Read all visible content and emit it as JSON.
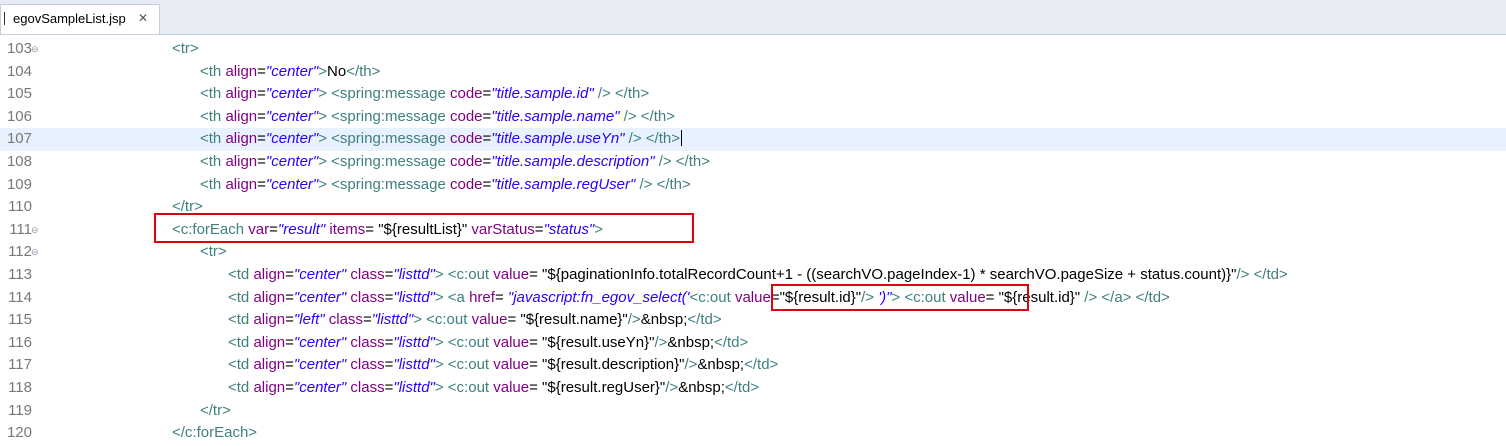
{
  "tab": {
    "label": "egovSampleList.jsp",
    "close_icon": "close-icon"
  },
  "editor": {
    "lines": [
      {
        "num": "103",
        "parts": [
          [
            "tg",
            "<tr>"
          ]
        ]
      },
      {
        "num": "104",
        "parts": [
          [
            "tg",
            "<th "
          ],
          [
            "at",
            "align"
          ],
          [
            "tx",
            "="
          ],
          [
            "vl",
            "\"center\""
          ],
          [
            "tg",
            ">"
          ],
          [
            "tx",
            "No"
          ],
          [
            "tg",
            "</th>"
          ]
        ]
      },
      {
        "num": "105",
        "parts": [
          [
            "tg",
            "<th "
          ],
          [
            "at",
            "align"
          ],
          [
            "tx",
            "="
          ],
          [
            "vl",
            "\"center\""
          ],
          [
            "tg",
            "> <spring:message "
          ],
          [
            "at",
            "code"
          ],
          [
            "tx",
            "="
          ],
          [
            "vl",
            "\"title.sample.id\""
          ],
          [
            "tg",
            " /> </th>"
          ]
        ]
      },
      {
        "num": "106",
        "parts": [
          [
            "tg",
            "<th "
          ],
          [
            "at",
            "align"
          ],
          [
            "tx",
            "="
          ],
          [
            "vl",
            "\"center\""
          ],
          [
            "tg",
            "> <spring:message "
          ],
          [
            "at",
            "code"
          ],
          [
            "tx",
            "="
          ],
          [
            "vl",
            "\"title.sample.name\""
          ],
          [
            "tg",
            " /> </th>"
          ]
        ]
      },
      {
        "num": "107",
        "parts": [
          [
            "tg",
            "<th "
          ],
          [
            "at",
            "align"
          ],
          [
            "tx",
            "="
          ],
          [
            "vl",
            "\"center\""
          ],
          [
            "tg",
            "> <spring:message "
          ],
          [
            "at",
            "code"
          ],
          [
            "tx",
            "="
          ],
          [
            "vl",
            "\"title.sample.useYn\""
          ],
          [
            "tg",
            " /> </th>"
          ]
        ]
      },
      {
        "num": "108",
        "parts": [
          [
            "tg",
            "<th "
          ],
          [
            "at",
            "align"
          ],
          [
            "tx",
            "="
          ],
          [
            "vl",
            "\"center\""
          ],
          [
            "tg",
            "> <spring:message "
          ],
          [
            "at",
            "code"
          ],
          [
            "tx",
            "="
          ],
          [
            "vl",
            "\"title.sample.description\""
          ],
          [
            "tg",
            " /> </th>"
          ]
        ]
      },
      {
        "num": "109",
        "parts": [
          [
            "tg",
            "<th "
          ],
          [
            "at",
            "align"
          ],
          [
            "tx",
            "="
          ],
          [
            "vl",
            "\"center\""
          ],
          [
            "tg",
            "> <spring:message "
          ],
          [
            "at",
            "code"
          ],
          [
            "tx",
            "="
          ],
          [
            "vl",
            "\"title.sample.regUser\""
          ],
          [
            "tg",
            " /> </th>"
          ]
        ]
      },
      {
        "num": "110",
        "parts": [
          [
            "tg",
            "</tr>"
          ]
        ]
      },
      {
        "num": "111",
        "parts": [
          [
            "tg",
            "<c:forEach "
          ],
          [
            "at",
            "var"
          ],
          [
            "tx",
            "="
          ],
          [
            "vl",
            "\"result\""
          ],
          [
            "tx",
            " "
          ],
          [
            "at",
            "items"
          ],
          [
            "tx",
            "= "
          ],
          [
            "el",
            "\"${resultList}\""
          ],
          [
            "tx",
            " "
          ],
          [
            "at",
            "varStatus"
          ],
          [
            "tx",
            "="
          ],
          [
            "vl",
            "\"status\""
          ],
          [
            "tg",
            ">"
          ]
        ]
      },
      {
        "num": "112",
        "parts": [
          [
            "tg",
            "<tr>"
          ]
        ]
      },
      {
        "num": "113",
        "parts": [
          [
            "tg",
            "<td "
          ],
          [
            "at",
            "align"
          ],
          [
            "tx",
            "="
          ],
          [
            "vl",
            "\"center\""
          ],
          [
            "tx",
            " "
          ],
          [
            "at",
            "class"
          ],
          [
            "tx",
            "="
          ],
          [
            "vl",
            "\"listtd\""
          ],
          [
            "tg",
            "> <c:out "
          ],
          [
            "at",
            "value"
          ],
          [
            "tx",
            "= "
          ],
          [
            "el",
            "\"${paginationInfo.totalRecordCount+1 - ((searchVO.pageIndex-1) * searchVO.pageSize + status.count)}\""
          ],
          [
            "tg",
            "/> </td>"
          ]
        ]
      },
      {
        "num": "114",
        "parts": [
          [
            "tg",
            "<td "
          ],
          [
            "at",
            "align"
          ],
          [
            "tx",
            "="
          ],
          [
            "vl",
            "\"center\""
          ],
          [
            "tx",
            " "
          ],
          [
            "at",
            "class"
          ],
          [
            "tx",
            "="
          ],
          [
            "vl",
            "\"listtd\""
          ],
          [
            "tg",
            "> <a "
          ],
          [
            "at",
            "href"
          ],
          [
            "tx",
            "= "
          ],
          [
            "vl",
            "\"javascript:fn_egov_select('"
          ],
          [
            "tg",
            "<c:out "
          ],
          [
            "at",
            "value"
          ],
          [
            "tx",
            "="
          ],
          [
            "el",
            "\"${result.id}\""
          ],
          [
            "tg",
            "/>"
          ],
          [
            "vl",
            " ')\""
          ],
          [
            "tg",
            "> <c:out "
          ],
          [
            "at",
            "value"
          ],
          [
            "tx",
            "= "
          ],
          [
            "el",
            "\"${result.id}\""
          ],
          [
            "tg",
            " /> </a> </td>"
          ]
        ]
      },
      {
        "num": "115",
        "parts": [
          [
            "tg",
            "<td "
          ],
          [
            "at",
            "align"
          ],
          [
            "tx",
            "="
          ],
          [
            "vl",
            "\"left\""
          ],
          [
            "tx",
            " "
          ],
          [
            "at",
            "class"
          ],
          [
            "tx",
            "="
          ],
          [
            "vl",
            "\"listtd\""
          ],
          [
            "tg",
            "> <c:out "
          ],
          [
            "at",
            "value"
          ],
          [
            "tx",
            "= "
          ],
          [
            "el",
            "\"${result.name}\""
          ],
          [
            "tg",
            "/>"
          ],
          [
            "tx",
            "&nbsp;"
          ],
          [
            "tg",
            "</td>"
          ]
        ]
      },
      {
        "num": "116",
        "parts": [
          [
            "tg",
            "<td "
          ],
          [
            "at",
            "align"
          ],
          [
            "tx",
            "="
          ],
          [
            "vl",
            "\"center\""
          ],
          [
            "tx",
            " "
          ],
          [
            "at",
            "class"
          ],
          [
            "tx",
            "="
          ],
          [
            "vl",
            "\"listtd\""
          ],
          [
            "tg",
            "> <c:out "
          ],
          [
            "at",
            "value"
          ],
          [
            "tx",
            "= "
          ],
          [
            "el",
            "\"${result.useYn}\""
          ],
          [
            "tg",
            "/>"
          ],
          [
            "tx",
            "&nbsp;"
          ],
          [
            "tg",
            "</td>"
          ]
        ]
      },
      {
        "num": "117",
        "parts": [
          [
            "tg",
            "<td "
          ],
          [
            "at",
            "align"
          ],
          [
            "tx",
            "="
          ],
          [
            "vl",
            "\"center\""
          ],
          [
            "tx",
            " "
          ],
          [
            "at",
            "class"
          ],
          [
            "tx",
            "="
          ],
          [
            "vl",
            "\"listtd\""
          ],
          [
            "tg",
            "> <c:out "
          ],
          [
            "at",
            "value"
          ],
          [
            "tx",
            "= "
          ],
          [
            "el",
            "\"${result.description}\""
          ],
          [
            "tg",
            "/>"
          ],
          [
            "tx",
            "&nbsp;"
          ],
          [
            "tg",
            "</td>"
          ]
        ]
      },
      {
        "num": "118",
        "parts": [
          [
            "tg",
            "<td "
          ],
          [
            "at",
            "align"
          ],
          [
            "tx",
            "="
          ],
          [
            "vl",
            "\"center\""
          ],
          [
            "tx",
            " "
          ],
          [
            "at",
            "class"
          ],
          [
            "tx",
            "="
          ],
          [
            "vl",
            "\"listtd\""
          ],
          [
            "tg",
            "> <c:out "
          ],
          [
            "at",
            "value"
          ],
          [
            "tx",
            "= "
          ],
          [
            "el",
            "\"${result.regUser}\""
          ],
          [
            "tg",
            "/>"
          ],
          [
            "tx",
            "&nbsp;"
          ],
          [
            "tg",
            "</td>"
          ]
        ]
      },
      {
        "num": "119",
        "parts": [
          [
            "tg",
            "</tr>"
          ]
        ]
      },
      {
        "num": "120",
        "parts": [
          [
            "tg",
            "</c:forEach>"
          ]
        ]
      }
    ]
  },
  "colors": {
    "tag": "#3f7f7f",
    "attribute": "#7f007f",
    "string_value": "#2a00ff",
    "highlight_box": "#e3000f",
    "current_line": "#e8f2fe"
  }
}
